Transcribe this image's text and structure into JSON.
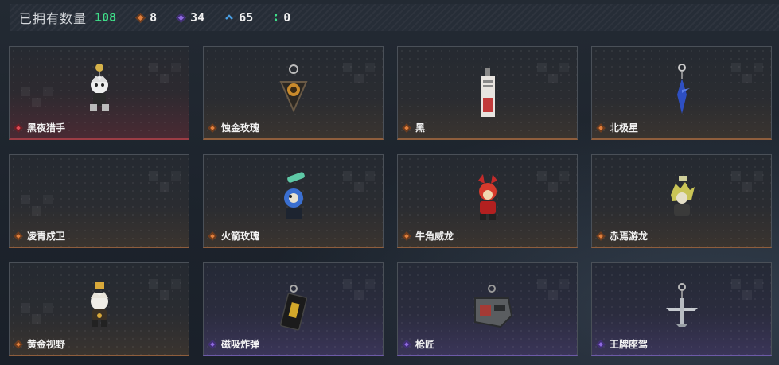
{
  "header": {
    "title": "已拥有数量",
    "total": "108",
    "counts": [
      {
        "icon": "orange-diamond-icon",
        "value": "8"
      },
      {
        "icon": "purple-diamond-icon",
        "value": "34"
      },
      {
        "icon": "blue-chevron-icon",
        "value": "65"
      },
      {
        "icon": "green-dots-icon",
        "value": "0"
      }
    ]
  },
  "colors": {
    "red": "#e04a55",
    "orange": "#e2803d",
    "purple": "#8f6ae0",
    "blue": "#4aa0e6",
    "green": "#3fe08a"
  },
  "items": [
    {
      "name": "黑夜猎手",
      "rarity": "red",
      "icon": "hunter-figure-charm"
    },
    {
      "name": "蚀金玫瑰",
      "rarity": "orange",
      "icon": "rose-emblem-charm"
    },
    {
      "name": "黑",
      "rarity": "orange",
      "icon": "tag-charm"
    },
    {
      "name": "北极星",
      "rarity": "orange",
      "icon": "star-charm"
    },
    {
      "name": "凌青戍卫",
      "rarity": "orange",
      "icon": "empty-slot"
    },
    {
      "name": "火箭玫瑰",
      "rarity": "orange",
      "icon": "rocket-figure-charm"
    },
    {
      "name": "牛角威龙",
      "rarity": "orange",
      "icon": "horned-figure-charm"
    },
    {
      "name": "赤焉游龙",
      "rarity": "orange",
      "icon": "dragon-figure-charm"
    },
    {
      "name": "黄金视野",
      "rarity": "orange",
      "icon": "golden-figure-charm"
    },
    {
      "name": "磁吸炸弹",
      "rarity": "purple",
      "icon": "bomb-charm"
    },
    {
      "name": "枪匠",
      "rarity": "purple",
      "icon": "gunsmith-badge-charm"
    },
    {
      "name": "王牌座驾",
      "rarity": "purple",
      "icon": "jet-charm"
    }
  ]
}
